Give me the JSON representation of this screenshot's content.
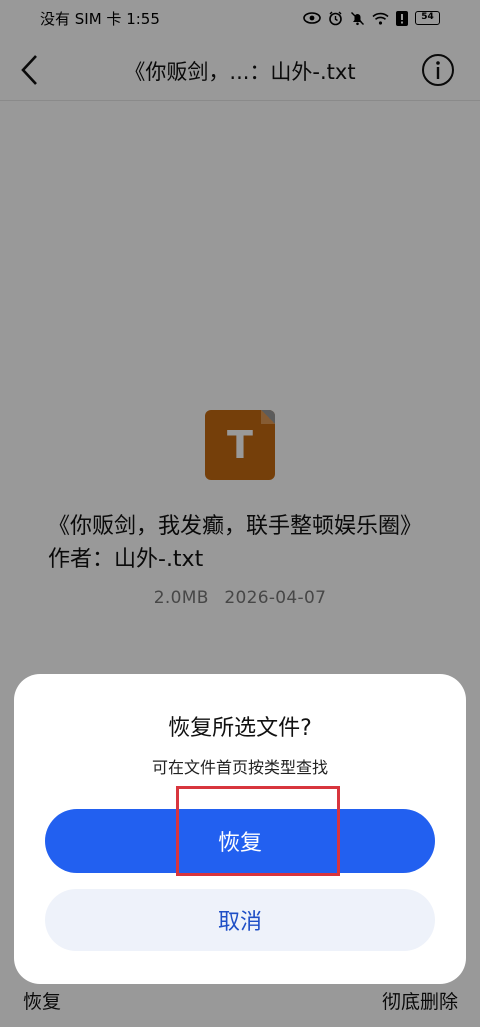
{
  "status_bar": {
    "carrier_time": "没有 SIM 卡 1:55",
    "battery": "54",
    "icons": [
      "eye-icon",
      "alarm-icon",
      "mute-icon",
      "wifi-icon",
      "alert-icon",
      "battery-icon"
    ]
  },
  "header": {
    "back_icon": "chevron-left-icon",
    "title": "《你贩剑，...：山外-.txt",
    "info_icon": "info-icon"
  },
  "file": {
    "icon_letter": "T",
    "icon_color": "#c46a12",
    "name": "《你贩剑，我发癫，联手整顿娱乐圈》作者：山外-.txt",
    "size": "2.0MB",
    "date": "2026-04-07"
  },
  "bottom_bar": {
    "restore_label": "恢复",
    "delete_label": "彻底删除"
  },
  "dialog": {
    "title": "恢复所选文件?",
    "subtitle": "可在文件首页按类型查找",
    "restore_button": "恢复",
    "cancel_button": "取消",
    "primary_color": "#2260f0",
    "highlight_color": "#d8353d"
  }
}
